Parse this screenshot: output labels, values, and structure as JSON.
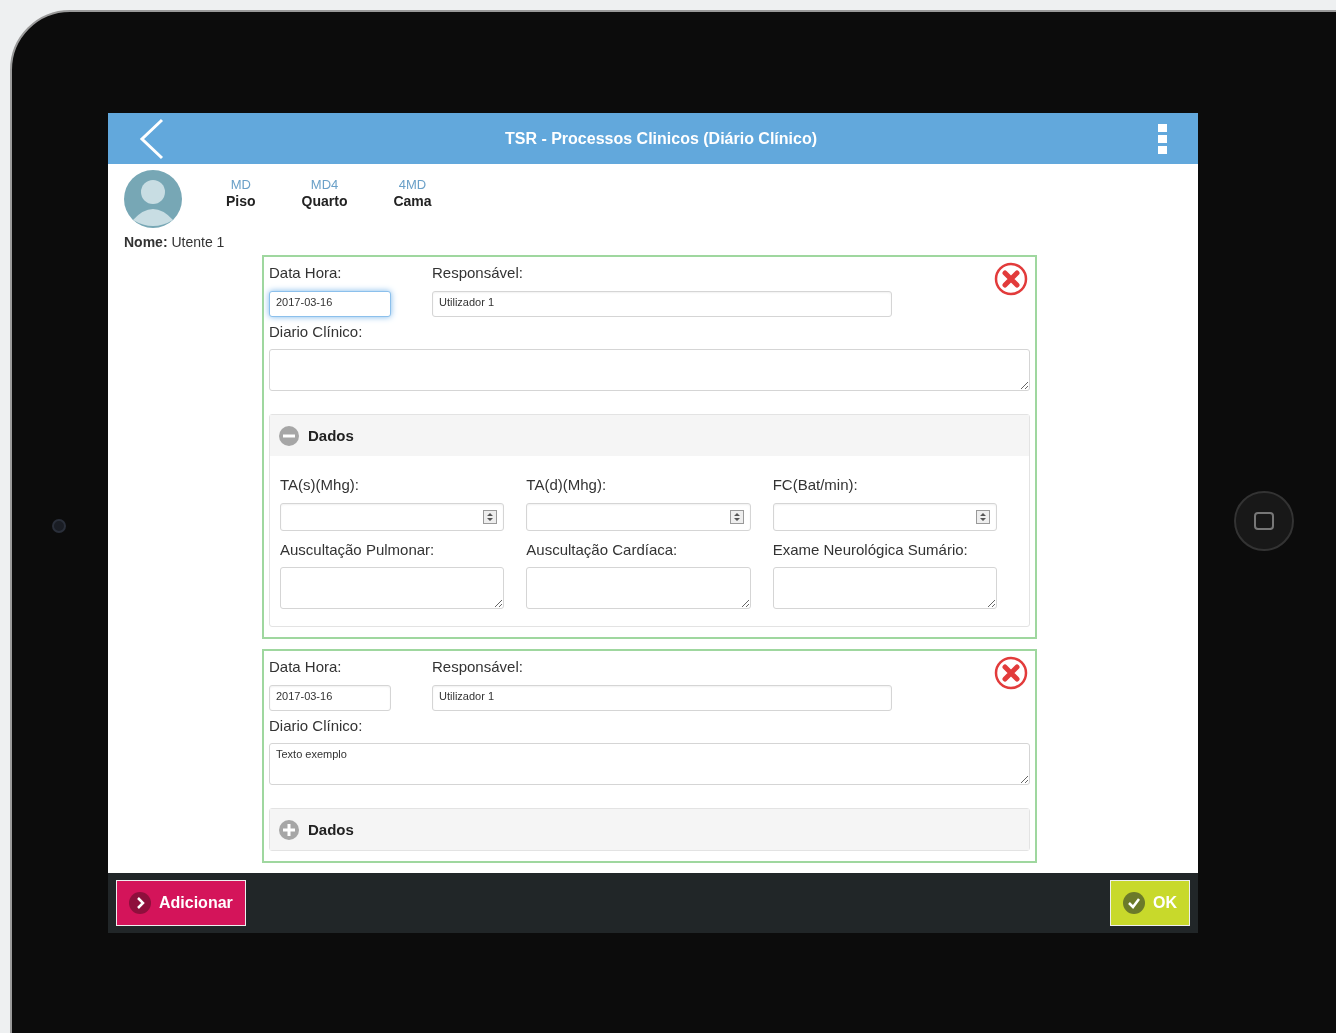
{
  "header": {
    "title": "TSR - Processos Clinicos (Diário Clínico)"
  },
  "patient": {
    "locations": [
      {
        "code": "MD",
        "label": "Piso"
      },
      {
        "code": "MD4",
        "label": "Quarto"
      },
      {
        "code": "4MD",
        "label": "Cama"
      }
    ],
    "name_label": "Nome:",
    "name": "Utente 1"
  },
  "records": [
    {
      "date_label": "Data Hora:",
      "date": "2017-03-16",
      "date_focused": true,
      "responsible_label": "Responsável:",
      "responsible": "Utilizador 1",
      "diary_label": "Diario Clínico:",
      "dados": {
        "title": "Dados",
        "expanded": true,
        "fields": [
          {
            "kind": "number",
            "label": "TA(s)(Mhg):"
          },
          {
            "kind": "number",
            "label": "TA(d)(Mhg):"
          },
          {
            "kind": "number",
            "label": "FC(Bat/min):"
          },
          {
            "kind": "textarea",
            "label": "Auscultação Pulmonar:"
          },
          {
            "kind": "textarea",
            "label": "Auscultação Cardíaca:"
          },
          {
            "kind": "textarea",
            "label": "Exame Neurológica Sumário:"
          }
        ]
      }
    },
    {
      "date_label": "Data Hora:",
      "date": "2017-03-16",
      "date_focused": false,
      "responsible_label": "Responsável:",
      "responsible": "Utilizador 1",
      "diary_label": "Diario Clínico:",
      "diary": "Texto exemplo",
      "dados": {
        "title": "Dados",
        "expanded": false
      }
    }
  ],
  "footer": {
    "add_button": "Adicionar",
    "ok_button": "OK"
  }
}
